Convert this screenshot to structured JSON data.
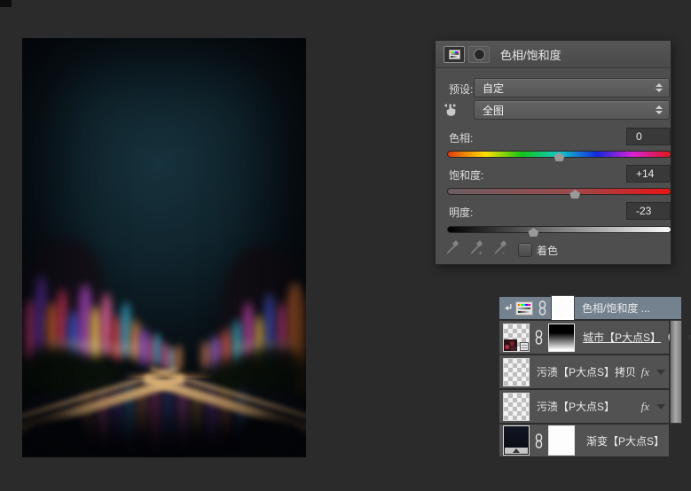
{
  "colors": {
    "workspace_bg": "#2b2b2b",
    "panel_bg": "#4e4e4e",
    "selected_layer_bg": "#73828e"
  },
  "properties_panel": {
    "title": "色相/饱和度",
    "preset_label": "预设:",
    "preset_value": "自定",
    "channel_value": "全图",
    "hue_label": "色相:",
    "hue_value": "0",
    "saturation_label": "饱和度:",
    "saturation_value": "+14",
    "lightness_label": "明度:",
    "lightness_value": "-23",
    "colorize_label": "着色",
    "colorize_checked": false,
    "slider_positions": {
      "hue_pct": 50,
      "saturation_pct": 57,
      "lightness_pct": 38.5
    }
  },
  "layers_panel": {
    "fx_label": "fx",
    "rows": [
      {
        "name": "色相/饱和度 ...",
        "selected": true,
        "type": "hue-saturation-adjustment",
        "clipped": true,
        "mask": "white"
      },
      {
        "name": "城市【P大点S】",
        "underlined": true,
        "mask": "black-to-white-gradient",
        "badge": "sphere",
        "has_expander": true
      },
      {
        "name": "污渍【P大点S】拷贝",
        "fx": true,
        "has_expander": true
      },
      {
        "name": "污渍【P大点S】",
        "fx": true,
        "has_expander": true
      },
      {
        "name": "渐变【P大点S】",
        "mask": "white"
      }
    ]
  }
}
